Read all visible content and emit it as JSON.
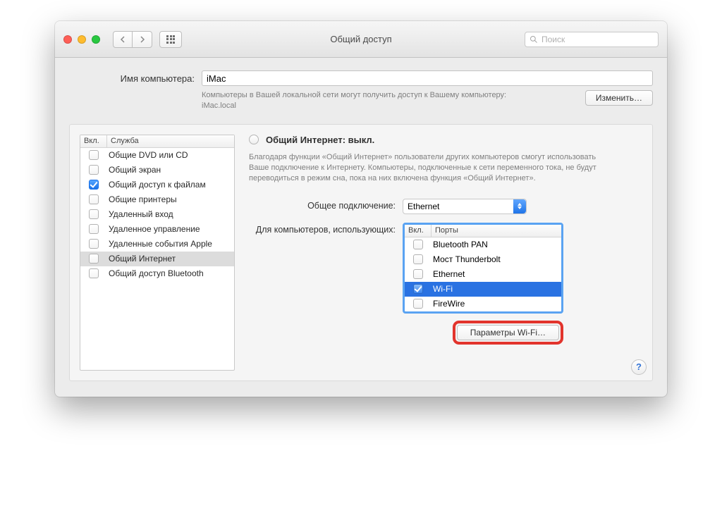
{
  "window": {
    "title": "Общий доступ"
  },
  "search": {
    "placeholder": "Поиск"
  },
  "computer_name": {
    "label": "Имя компьютера:",
    "value": "iMac",
    "description": "Компьютеры в Вашей локальной сети могут получить доступ к Вашему компьютеру: iMac.local",
    "edit_button": "Изменить…"
  },
  "services": {
    "col_enabled": "Вкл.",
    "col_service": "Служба",
    "items": [
      {
        "label": "Общие DVD или CD",
        "checked": false
      },
      {
        "label": "Общий экран",
        "checked": false
      },
      {
        "label": "Общий доступ к файлам",
        "checked": true
      },
      {
        "label": "Общие принтеры",
        "checked": false
      },
      {
        "label": "Удаленный вход",
        "checked": false
      },
      {
        "label": "Удаленное управление",
        "checked": false
      },
      {
        "label": "Удаленные события Apple",
        "checked": false
      },
      {
        "label": "Общий Интернет",
        "checked": false,
        "selected": true
      },
      {
        "label": "Общий доступ Bluetooth",
        "checked": false
      }
    ]
  },
  "detail": {
    "title": "Общий Интернет: выкл.",
    "description": "Благодаря функции «Общий Интернет» пользователи других компьютеров смогут использовать Ваше подключение к Интернету. Компьютеры, подключенные к сети переменного тока, не будут переводиться в режим сна, пока на них включена функция «Общий Интернет».",
    "share_from_label": "Общее подключение:",
    "share_from_value": "Ethernet",
    "to_label": "Для компьютеров, использующих:",
    "ports": {
      "col_enabled": "Вкл.",
      "col_ports": "Порты",
      "items": [
        {
          "label": "Bluetooth PAN",
          "checked": false
        },
        {
          "label": "Мост Thunderbolt",
          "checked": false
        },
        {
          "label": "Ethernet",
          "checked": false
        },
        {
          "label": "Wi-Fi",
          "checked": true,
          "selected": true
        },
        {
          "label": "FireWire",
          "checked": false
        }
      ]
    },
    "wifi_options_button": "Параметры Wi-Fi…"
  },
  "help": "?"
}
